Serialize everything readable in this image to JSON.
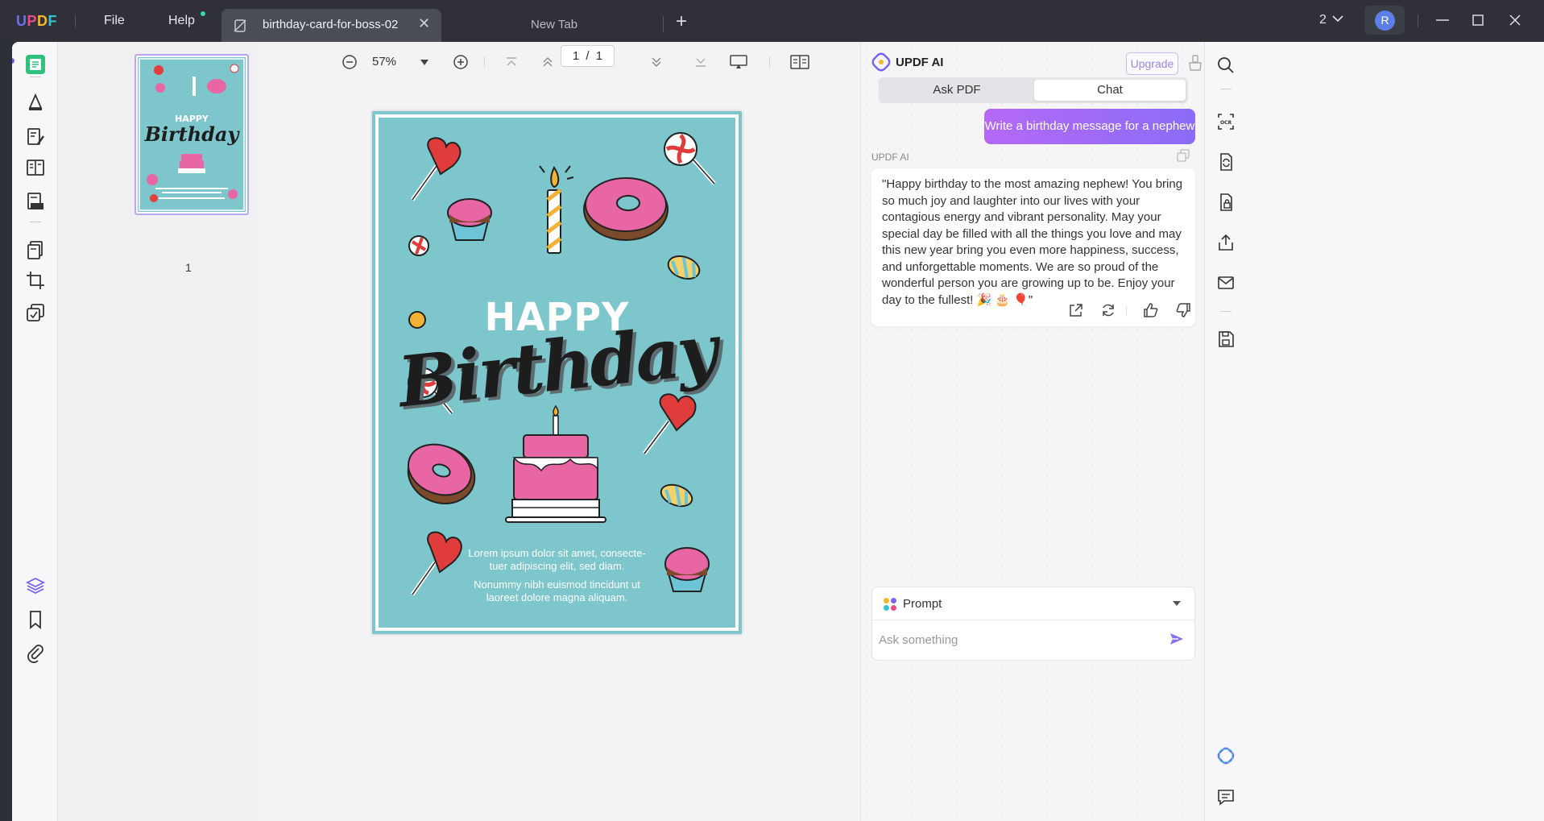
{
  "app": {
    "logo_letters": [
      "U",
      "P",
      "D",
      "F"
    ],
    "menu_file": "File",
    "menu_help": "Help",
    "tabs": [
      {
        "title": "birthday-card-for-boss-02",
        "active": true
      },
      {
        "title": "New Tab",
        "active": false
      }
    ],
    "window_count": "2",
    "avatar_initial": "R"
  },
  "viewer": {
    "zoom": "57%",
    "page_current": "1",
    "page_total": "1",
    "page_separator": "/",
    "thumbnail_label": "1"
  },
  "card": {
    "happy": "HAPPY",
    "birthday": "Birthday",
    "text_1_line_1": "Lorem ipsum dolor sit amet, consecte-",
    "text_1_line_2": "tuer adipiscing elit, sed diam.",
    "text_2_line_1": "Nonummy nibh euismod tincidunt ut",
    "text_2_line_2": "laoreet dolore magna aliquam.",
    "background_color": "#7cc6cc"
  },
  "ai": {
    "title": "UPDF AI",
    "upgrade": "Upgrade",
    "tab_ask_pdf": "Ask PDF",
    "tab_chat": "Chat",
    "active_tab": "Chat",
    "user_message": "Write a birthday message for a nephew",
    "response_label": "UPDF AI",
    "response_text": "\"Happy birthday to the most amazing nephew! You bring so much joy and laughter into our lives with your contagious energy and vibrant personality. May your special day be filled with all the things you love and may this new year bring you even more happiness, success, and unforgettable moments. We are so proud of the wonderful person you are growing up to be. Enjoy your day to the fullest! 🎉 🎂 🎈\"",
    "prompt_label": "Prompt",
    "input_placeholder": "Ask something",
    "accent_color": "#8b6cf7"
  },
  "icons": {
    "left_toolbar": [
      "reader-icon",
      "comment-icon",
      "edit-pdf-icon",
      "organize-pages-icon",
      "fill-sign-icon",
      "page-tools-icon",
      "crop-icon",
      "protect-icon",
      "layers-icon",
      "bookmark-icon",
      "attachment-icon"
    ],
    "right_toolbar": [
      "search-icon",
      "ocr-icon",
      "convert-icon",
      "protect-doc-icon",
      "share-icon",
      "email-icon",
      "save-icon",
      "updf-ai-icon",
      "comments-panel-icon"
    ]
  }
}
